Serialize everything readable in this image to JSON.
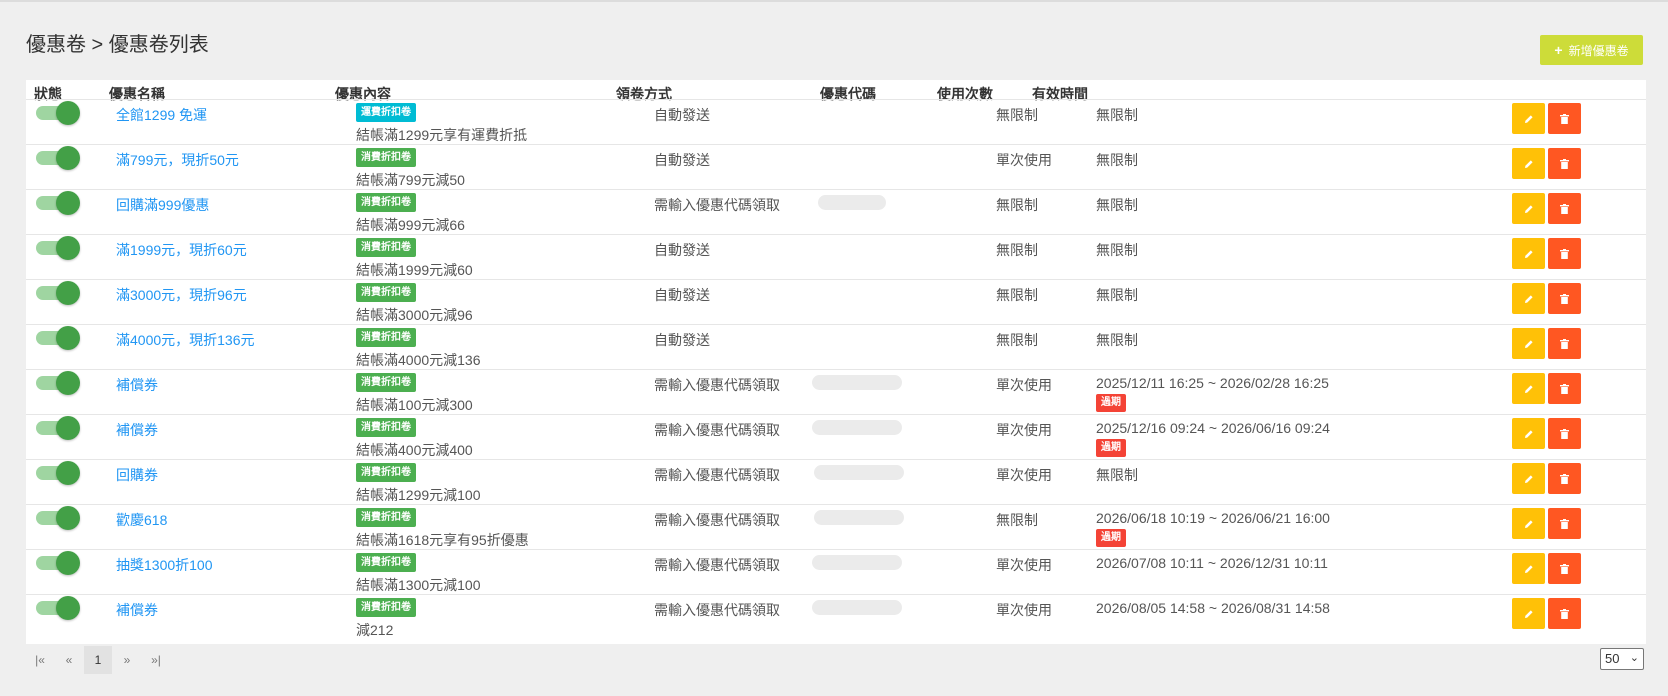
{
  "breadcrumb": "優惠卷 > 優惠卷列表",
  "add_button": "新增優惠卷",
  "columns": {
    "status": "狀態",
    "name": "優惠名稱",
    "content": "優惠內容",
    "method": "領卷方式",
    "code": "優惠代碼",
    "usage": "使用次數",
    "validity": "有效時間"
  },
  "rows": [
    {
      "enabled": true,
      "name": "全館1299 免運",
      "type": "運費折扣卷",
      "type_kind": "shipping",
      "desc": "結帳滿1299元享有運費折抵",
      "method": "自動發送",
      "has_code": false,
      "usage": "無限制",
      "validity": "無限制",
      "expired": ""
    },
    {
      "enabled": true,
      "name": "滿799元，現折50元",
      "type": "消費折扣卷",
      "type_kind": "consumption",
      "desc": "結帳滿799元減50",
      "method": "自動發送",
      "has_code": false,
      "usage": "單次使用",
      "validity": "無限制",
      "expired": ""
    },
    {
      "enabled": true,
      "name": "回購滿999優惠",
      "type": "消費折扣卷",
      "type_kind": "consumption",
      "desc": "結帳滿999元減66",
      "method": "需輸入優惠代碼領取",
      "has_code": true,
      "usage": "無限制",
      "validity": "無限制",
      "expired": ""
    },
    {
      "enabled": true,
      "name": "滿1999元，現折60元",
      "type": "消費折扣卷",
      "type_kind": "consumption",
      "desc": "結帳滿1999元減60",
      "method": "自動發送",
      "has_code": false,
      "usage": "無限制",
      "validity": "無限制",
      "expired": ""
    },
    {
      "enabled": true,
      "name": "滿3000元，現折96元",
      "type": "消費折扣卷",
      "type_kind": "consumption",
      "desc": "結帳滿3000元減96",
      "method": "自動發送",
      "has_code": false,
      "usage": "無限制",
      "validity": "無限制",
      "expired": ""
    },
    {
      "enabled": true,
      "name": "滿4000元，現折136元",
      "type": "消費折扣卷",
      "type_kind": "consumption",
      "desc": "結帳滿4000元減136",
      "method": "自動發送",
      "has_code": false,
      "usage": "無限制",
      "validity": "無限制",
      "expired": ""
    },
    {
      "enabled": true,
      "name": "補償券",
      "type": "消費折扣卷",
      "type_kind": "consumption",
      "desc": "結帳滿100元減300",
      "method": "需輸入優惠代碼領取",
      "has_code": true,
      "usage": "單次使用",
      "validity": "2025/12/11 16:25 ~ 2026/02/28 16:25",
      "expired": "過期"
    },
    {
      "enabled": true,
      "name": "補償券",
      "type": "消費折扣卷",
      "type_kind": "consumption",
      "desc": "結帳滿400元減400",
      "method": "需輸入優惠代碼領取",
      "has_code": true,
      "usage": "單次使用",
      "validity": "2025/12/16 09:24 ~ 2026/06/16 09:24",
      "expired": "過期"
    },
    {
      "enabled": true,
      "name": "回購券",
      "type": "消費折扣卷",
      "type_kind": "consumption",
      "desc": "結帳滿1299元減100",
      "method": "需輸入優惠代碼領取",
      "has_code": true,
      "usage": "單次使用",
      "validity": "無限制",
      "expired": ""
    },
    {
      "enabled": true,
      "name": "歡慶618",
      "type": "消費折扣卷",
      "type_kind": "consumption",
      "desc": "結帳滿1618元享有95折優惠",
      "method": "需輸入優惠代碼領取",
      "has_code": true,
      "usage": "無限制",
      "validity": "2026/06/18 10:19 ~ 2026/06/21 16:00",
      "expired": "過期"
    },
    {
      "enabled": true,
      "name": "抽獎1300折100",
      "type": "消費折扣卷",
      "type_kind": "consumption",
      "desc": "結帳滿1300元減100",
      "method": "需輸入優惠代碼領取",
      "has_code": true,
      "usage": "單次使用",
      "validity": "2026/07/08 10:11 ~ 2026/12/31 10:11",
      "expired": ""
    },
    {
      "enabled": true,
      "name": "補償券",
      "type": "消費折扣卷",
      "type_kind": "consumption",
      "desc": "減212",
      "method": "需輸入優惠代碼領取",
      "has_code": true,
      "usage": "單次使用",
      "validity": "2026/08/05 14:58 ~ 2026/08/31 14:58",
      "expired": ""
    }
  ],
  "pagination": {
    "first": "|«",
    "prev": "«",
    "current": "1",
    "next": "»",
    "last": "»|",
    "per_page": "50"
  },
  "colors": {
    "accent_green": "#4caf50",
    "shipping_badge": "#00bcd4",
    "add_button": "#cddc39",
    "edit_button": "#ffc107",
    "delete_button": "#ff5722",
    "expired_badge": "#f44336",
    "link": "#2196f3"
  },
  "icons": {
    "edit": "pencil-icon",
    "delete": "trash-icon"
  }
}
